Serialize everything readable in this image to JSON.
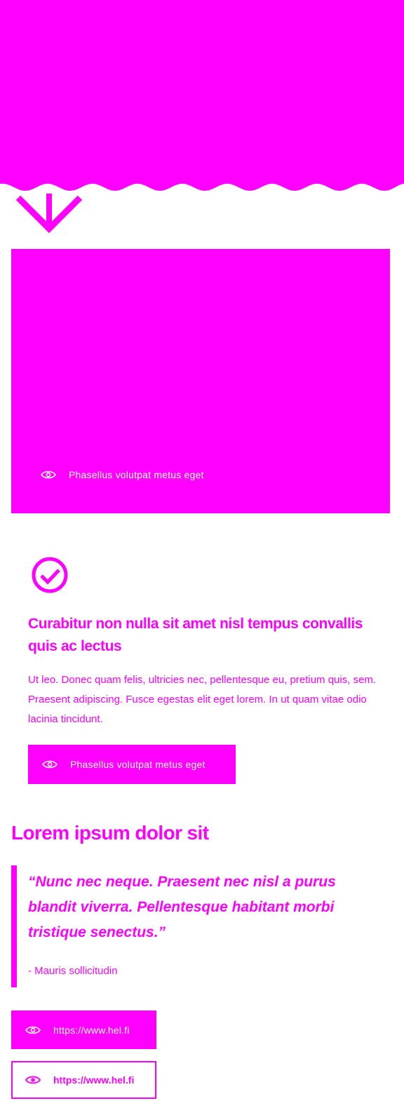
{
  "colors": {
    "accent": "#ff00ff",
    "background": "#ffffff",
    "on_accent": "#ffffff"
  },
  "hero": {
    "icon": "chevron-down-arrow-icon"
  },
  "media_card": {
    "caption": "Phasellus volutpat metus eget",
    "icon": "eye-icon"
  },
  "feature": {
    "icon": "check-circle-icon",
    "title": "Curabitur non nulla sit amet nisl tempus convallis quis ac lectus",
    "text": "Ut leo. Donec quam felis, ultricies nec, pellentesque eu, pretium quis, sem. Praesent adipiscing. Fusce egestas elit eget lorem. In ut quam vitae odio lacinia tincidunt.",
    "button_label": "Phasellus volutpat metus eget"
  },
  "section": {
    "heading": "Lorem ipsum dolor sit"
  },
  "quote": {
    "text": "“Nunc nec neque. Praesent nec nisl a purus blandit viverra. Pellentesque habitant morbi tristique senectus.”",
    "author": "- Mauris sollicitudin"
  },
  "links": {
    "primary_label": "https://www.hel.fi",
    "secondary_label": "https://www.hel.fi"
  }
}
